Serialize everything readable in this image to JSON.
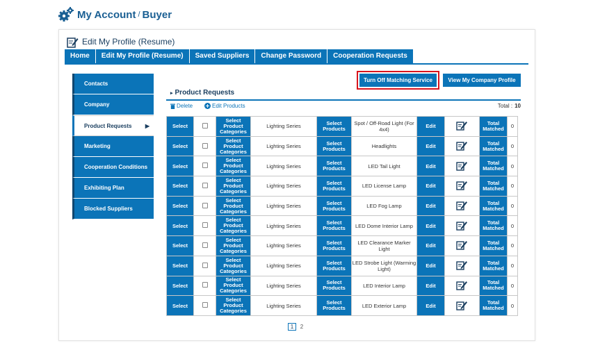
{
  "header": {
    "title": "My Account",
    "separator": "/",
    "subtitle": "Buyer"
  },
  "section": {
    "title": "Edit My Profile (Resume)"
  },
  "tabs": [
    {
      "label": "Home"
    },
    {
      "label": "Edit My Profile (Resume)"
    },
    {
      "label": "Saved Suppliers"
    },
    {
      "label": "Change Password"
    },
    {
      "label": "Cooperation Requests"
    }
  ],
  "sidebar": {
    "items": [
      {
        "label": "Contacts"
      },
      {
        "label": "Company"
      },
      {
        "label": "Product Requests",
        "arrow": "▶"
      },
      {
        "label": "Marketing"
      },
      {
        "label": "Cooperation Conditions"
      },
      {
        "label": "Exhibiting Plan"
      },
      {
        "label": "Blocked Suppliers"
      }
    ]
  },
  "actions": {
    "turn_off": "Turn Off Matching Service",
    "view_profile": "View My Company Profile"
  },
  "product_requests": {
    "title": "Product Requests",
    "delete_label": "Delete",
    "edit_label": "Edit Products",
    "total_label": "Total :",
    "total_value": "10"
  },
  "table": {
    "select_label": "Select",
    "categories_label": "Select Product Categories",
    "products_label": "Select Products",
    "edit_label": "Edit",
    "total_matched_label": "Total Matched",
    "rows": [
      {
        "series": "Lighting Series",
        "name": "Spot / Off-Road Light (For 4x4)",
        "count": "0"
      },
      {
        "series": "Lighting Series",
        "name": "Headlights",
        "count": "0"
      },
      {
        "series": "Lighting Series",
        "name": "LED Tail Light",
        "count": "0"
      },
      {
        "series": "Lighting Series",
        "name": "LED License Lamp",
        "count": "0"
      },
      {
        "series": "Lighting Series",
        "name": "LED Fog Lamp",
        "count": "0"
      },
      {
        "series": "Lighting Series",
        "name": "LED Dome Interior Lamp",
        "count": "0"
      },
      {
        "series": "Lighting Series",
        "name": "LED Clearance Marker Light",
        "count": "0"
      },
      {
        "series": "Lighting Series",
        "name": "LED Strobe Light (Warming Light)",
        "count": "0"
      },
      {
        "series": "Lighting Series",
        "name": "LED Interior Lamp",
        "count": "0"
      },
      {
        "series": "Lighting Series",
        "name": "LED Exterior Lamp",
        "count": "0"
      }
    ]
  },
  "pagination": {
    "pages": [
      "1",
      "2"
    ],
    "current": "1"
  },
  "colors": {
    "accent": "#0b74b8",
    "highlight": "#d8141d",
    "heading": "#1a5f93"
  }
}
